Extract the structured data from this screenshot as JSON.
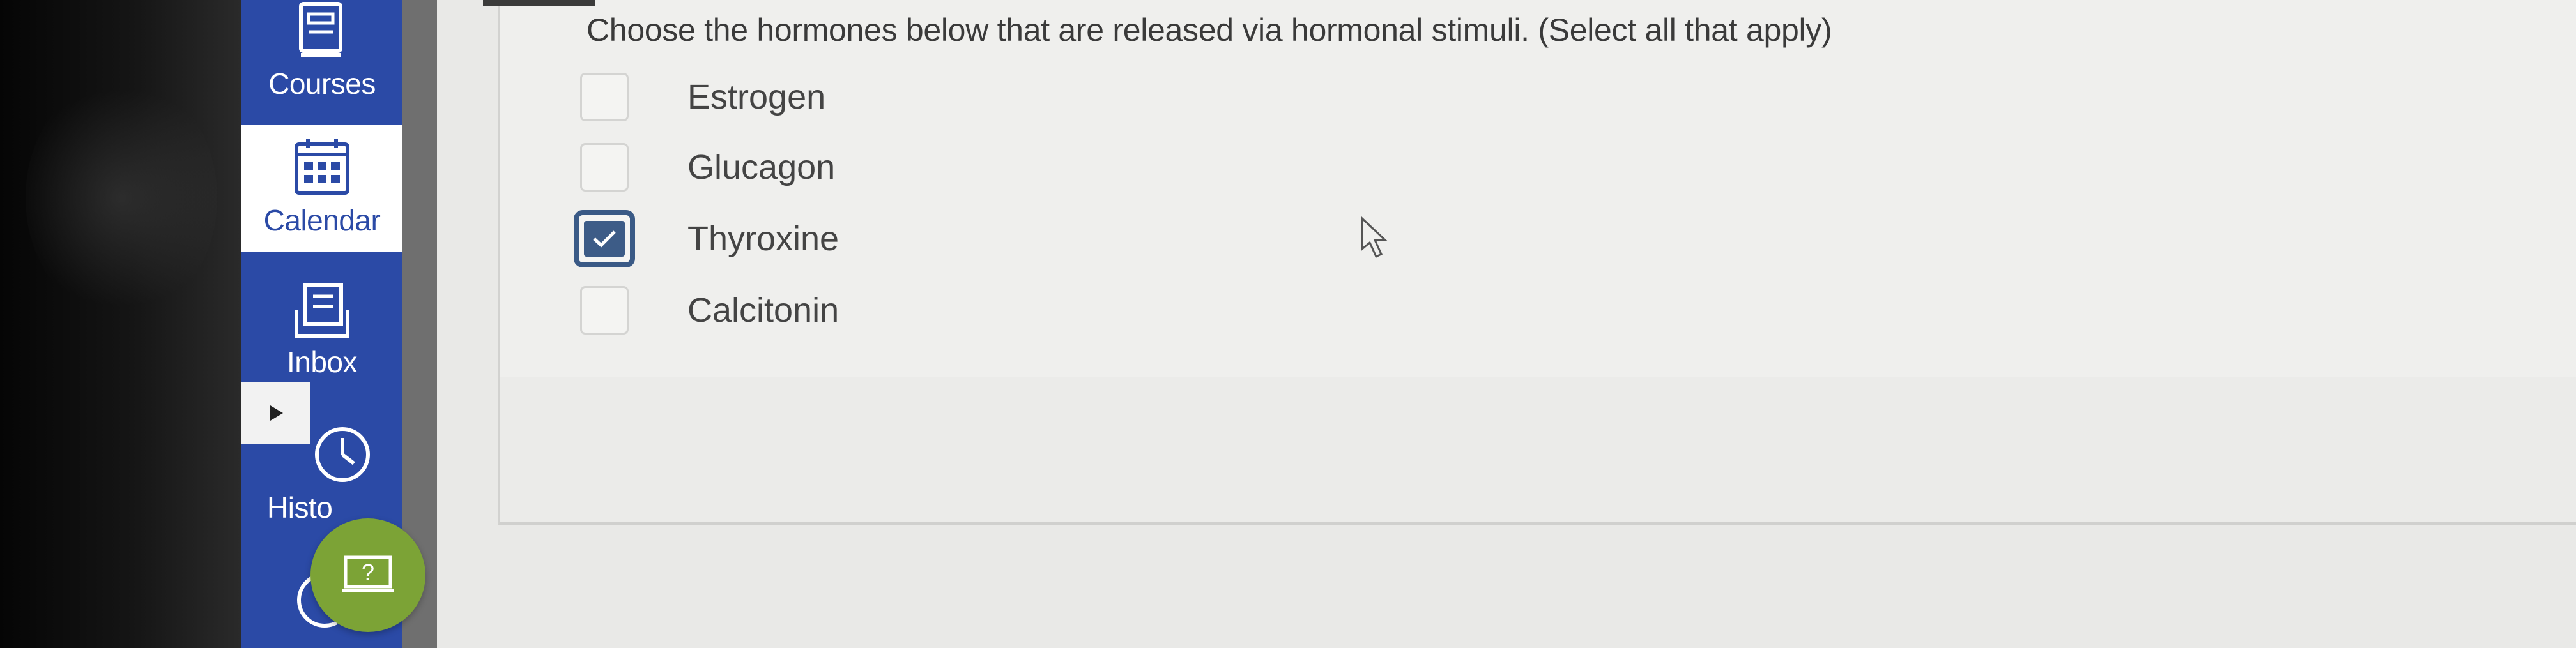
{
  "nav": {
    "items": [
      {
        "label": "Courses",
        "icon": "courses-icon"
      },
      {
        "label": "Calendar",
        "icon": "calendar-icon"
      },
      {
        "label": "Inbox",
        "icon": "inbox-icon"
      },
      {
        "label": "Histo",
        "icon": "history-icon"
      }
    ],
    "active": "Calendar",
    "brand_color": "#2b4aa6"
  },
  "help_button": {
    "glyph": "?",
    "color": "#7ca336"
  },
  "question": {
    "text": "Choose the hormones below that are released via hormonal stimuli. (Select all that apply)",
    "answers": [
      {
        "label": "Estrogen",
        "checked": false
      },
      {
        "label": "Glucagon",
        "checked": false
      },
      {
        "label": "Thyroxine",
        "checked": true
      },
      {
        "label": "Calcitonin",
        "checked": false
      }
    ]
  },
  "colors": {
    "checked": "#3a5a86",
    "text": "#3a3a3a"
  }
}
